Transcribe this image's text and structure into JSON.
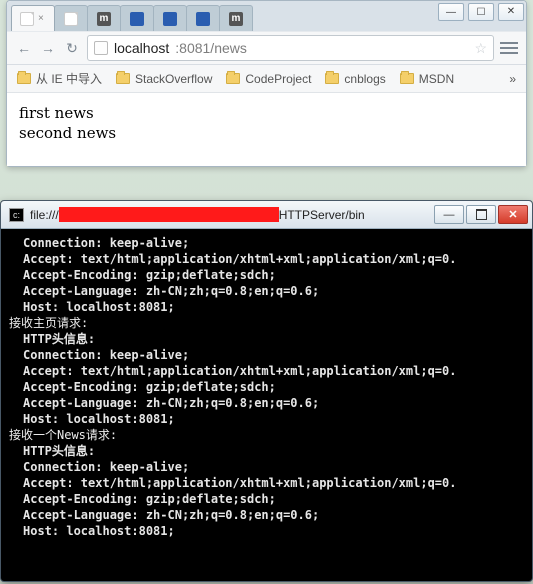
{
  "browser": {
    "window_controls": {
      "min": "—",
      "max": "☐",
      "close": "✕"
    },
    "tabs": [
      {
        "favicon": "doc",
        "close": true,
        "active": true
      },
      {
        "favicon": "doc"
      },
      {
        "favicon": "m"
      },
      {
        "favicon": "blue"
      },
      {
        "favicon": "blue"
      },
      {
        "favicon": "blue"
      },
      {
        "favicon": "m"
      }
    ],
    "nav": {
      "back": "←",
      "forward": "→",
      "reload": "↻"
    },
    "omnibox": {
      "host": "localhost",
      "port_path": ":8081/news",
      "star": "☆"
    },
    "bookmarks": [
      {
        "label": "从 IE 中导入"
      },
      {
        "label": "StackOverflow"
      },
      {
        "label": "CodeProject"
      },
      {
        "label": "cnblogs"
      },
      {
        "label": "MSDN"
      }
    ],
    "bookmarks_more": "»",
    "page_lines": [
      "first news",
      "second news"
    ]
  },
  "console": {
    "title_prefix": "file:///",
    "title_suffix": "HTTPServer/bin",
    "window_controls": {
      "min": "—",
      "close": "✕"
    },
    "blocks": [
      {
        "heading": null,
        "lines": [
          "Connection: keep-alive;",
          "Accept: text/html;application/xhtml+xml;application/xml;q=0.",
          "Accept-Encoding: gzip;deflate;sdch;",
          "Accept-Language: zh-CN;zh;q=0.8;en;q=0.6;",
          "Host: localhost:8081;"
        ]
      },
      {
        "heading": "接收主页请求:",
        "subheading": "HTTP头信息:",
        "lines": [
          "Connection: keep-alive;",
          "Accept: text/html;application/xhtml+xml;application/xml;q=0.",
          "Accept-Encoding: gzip;deflate;sdch;",
          "Accept-Language: zh-CN;zh;q=0.8;en;q=0.6;",
          "Host: localhost:8081;"
        ]
      },
      {
        "heading": "接收一个News请求:",
        "subheading": "HTTP头信息:",
        "lines": [
          "Connection: keep-alive;",
          "Accept: text/html;application/xhtml+xml;application/xml;q=0.",
          "Accept-Encoding: gzip;deflate;sdch;",
          "Accept-Language: zh-CN;zh;q=0.8;en;q=0.6;",
          "Host: localhost:8081;"
        ]
      }
    ]
  }
}
